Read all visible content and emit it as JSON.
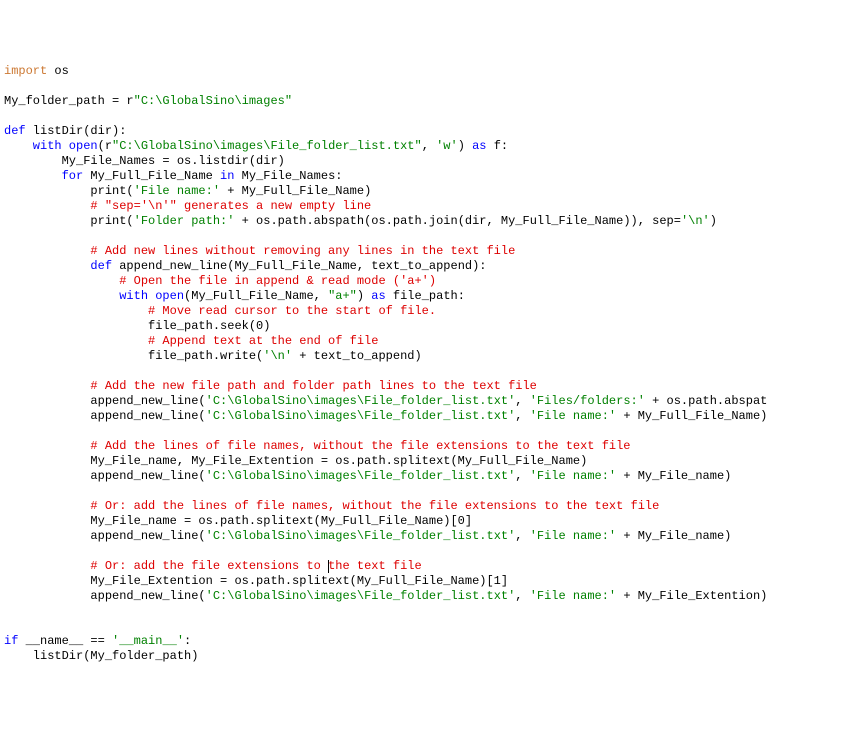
{
  "code": {
    "l1_import": "import",
    "l1_os": " os",
    "l3_a": "My_folder_path = r",
    "l3_b": "\"C:\\GlobalSino\\images\"",
    "l5_def": "def",
    "l5_rest": " listDir(dir):",
    "l6_with": "    with",
    "l6_open": " open",
    "l6_a": "(r",
    "l6_s": "\"C:\\GlobalSino\\images\\File_folder_list.txt\"",
    "l6_b": ", ",
    "l6_s2": "'w'",
    "l6_c": ") ",
    "l6_as": "as",
    "l6_d": " f:",
    "l7": "        My_File_Names = os.listdir(dir)",
    "l8_for": "        for",
    "l8_a": " My_Full_File_Name ",
    "l8_in": "in",
    "l8_b": " My_File_Names:",
    "l9_a": "            print(",
    "l9_s": "'File name:'",
    "l9_b": " + My_Full_File_Name)",
    "l10": "            # \"sep='\\n'\" generates a new empty line",
    "l11_a": "            print(",
    "l11_s": "'Folder path:'",
    "l11_b": " + os.path.abspath(os.path.join(dir, My_Full_File_Name)), sep=",
    "l11_s2": "'\\n'",
    "l11_c": ")",
    "l13": "            # Add new lines without removing any lines in the text file",
    "l14_def": "            def",
    "l14_a": " append_new_line(My_Full_File_Name, text_to_append):",
    "l15": "                # Open the file in append & read mode ('a+')",
    "l16_with": "                with",
    "l16_open": " open",
    "l16_a": "(My_Full_File_Name, ",
    "l16_s": "\"a+\"",
    "l16_b": ") ",
    "l16_as": "as",
    "l16_c": " file_path:",
    "l17": "                    # Move read cursor to the start of file.",
    "l18": "                    file_path.seek(0)",
    "l19": "                    # Append text at the end of file",
    "l20_a": "                    file_path.write(",
    "l20_s": "'\\n'",
    "l20_b": " + text_to_append)",
    "l22": "            # Add the new file path and folder path lines to the text file",
    "l23_a": "            append_new_line(",
    "l23_s1": "'C:\\GlobalSino\\images\\File_folder_list.txt'",
    "l23_b": ", ",
    "l23_s2": "'Files/folders:'",
    "l23_c": " + os.path.abspat",
    "l24_a": "            append_new_line(",
    "l24_s1": "'C:\\GlobalSino\\images\\File_folder_list.txt'",
    "l24_b": ", ",
    "l24_s2": "'File name:'",
    "l24_c": " + My_Full_File_Name)",
    "l26": "            # Add the lines of file names, without the file extensions to the text file",
    "l27": "            My_File_name, My_File_Extention = os.path.splitext(My_Full_File_Name)",
    "l28_a": "            append_new_line(",
    "l28_s1": "'C:\\GlobalSino\\images\\File_folder_list.txt'",
    "l28_b": ", ",
    "l28_s2": "'File name:'",
    "l28_c": " + My_File_name)",
    "l30": "            # Or: add the lines of file names, without the file extensions to the text file",
    "l31": "            My_File_name = os.path.splitext(My_Full_File_Name)[0]",
    "l32_a": "            append_new_line(",
    "l32_s1": "'C:\\GlobalSino\\images\\File_folder_list.txt'",
    "l32_b": ", ",
    "l32_s2": "'File name:'",
    "l32_c": " + My_File_name)",
    "l34a": "            # Or: add the file extensions to ",
    "l34b": "the text file",
    "l35": "            My_File_Extention = os.path.splitext(My_Full_File_Name)[1]",
    "l36_a": "            append_new_line(",
    "l36_s1": "'C:\\GlobalSino\\images\\File_folder_list.txt'",
    "l36_b": ", ",
    "l36_s2": "'File name:'",
    "l36_c": " + My_File_Extention)",
    "l39_if": "if",
    "l39_a": " __name__ == ",
    "l39_s": "'__main__'",
    "l39_b": ":",
    "l40": "    listDir(My_folder_path)"
  }
}
